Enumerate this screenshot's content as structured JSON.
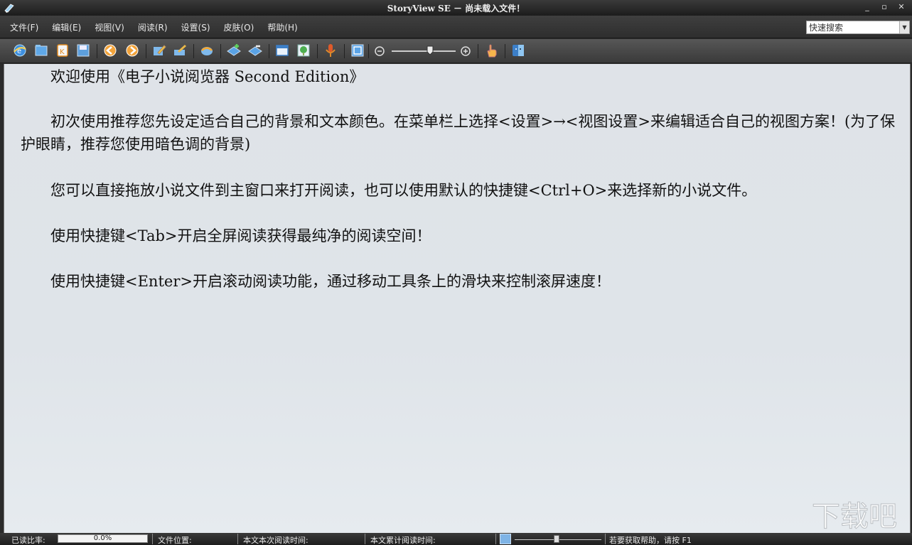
{
  "window": {
    "title": "StoryView SE － 尚未载入文件！",
    "controls": [
      "_",
      "▫",
      "✕"
    ]
  },
  "menu": {
    "items": [
      "文件(F)",
      "编辑(E)",
      "视图(V)",
      "阅读(R)",
      "设置(S)",
      "皮肤(O)",
      "帮助(H)"
    ],
    "quick_search_placeholder": "快速搜索"
  },
  "toolbar": {
    "buttons": [
      "ie-icon",
      "open-folder-icon",
      "bookmark-k-icon",
      "save-disk-icon",
      "back-icon",
      "forward-icon",
      "edit-pencil-icon",
      "brush-icon",
      "color-swirl-icon",
      "add-bookmark-icon",
      "remove-bookmark-icon",
      "window-icon",
      "tree-icon",
      "microphone-icon",
      "fullscreen-icon",
      "zoom-out-icon",
      "zoom-in-icon",
      "hand-pointer-icon",
      "mac-finder-icon"
    ],
    "zoom_level_fraction": 0.6
  },
  "content": {
    "paragraphs": [
      "　　欢迎使用《电子小说阅览器 Second Edition》",
      "　　初次使用推荐您先设定适合自己的背景和文本颜色。在菜单栏上选择<设置>→<视图设置>来编辑适合自己的视图方案！(为了保护眼睛，推荐您使用暗色调的背景)",
      "　　您可以直接拖放小说文件到主窗口来打开阅读，也可以使用默认的快捷键<Ctrl+O>来选择新的小说文件。",
      "　　使用快捷键<Tab>开启全屏阅读获得最纯净的阅读空间！",
      "　　使用快捷键<Enter>开启滚动阅读功能，通过移动工具条上的滑块来控制滚屏速度！"
    ],
    "watermark": "下载吧"
  },
  "status": {
    "read_ratio_label": "已读比率:",
    "read_ratio_value": "0.0%",
    "read_ratio_fraction": 0.0,
    "file_position_label": "文件位置:",
    "session_time_label": "本文本次阅读时间:",
    "total_time_label": "本文累计阅读时间:",
    "scroll_speed_fraction": 0.48,
    "help_text": "若要获取帮助，请按 F1"
  },
  "colors": {
    "chrome_dark": "#2e2e2e",
    "content_bg": "#dfe3e8",
    "text": "#111111"
  }
}
